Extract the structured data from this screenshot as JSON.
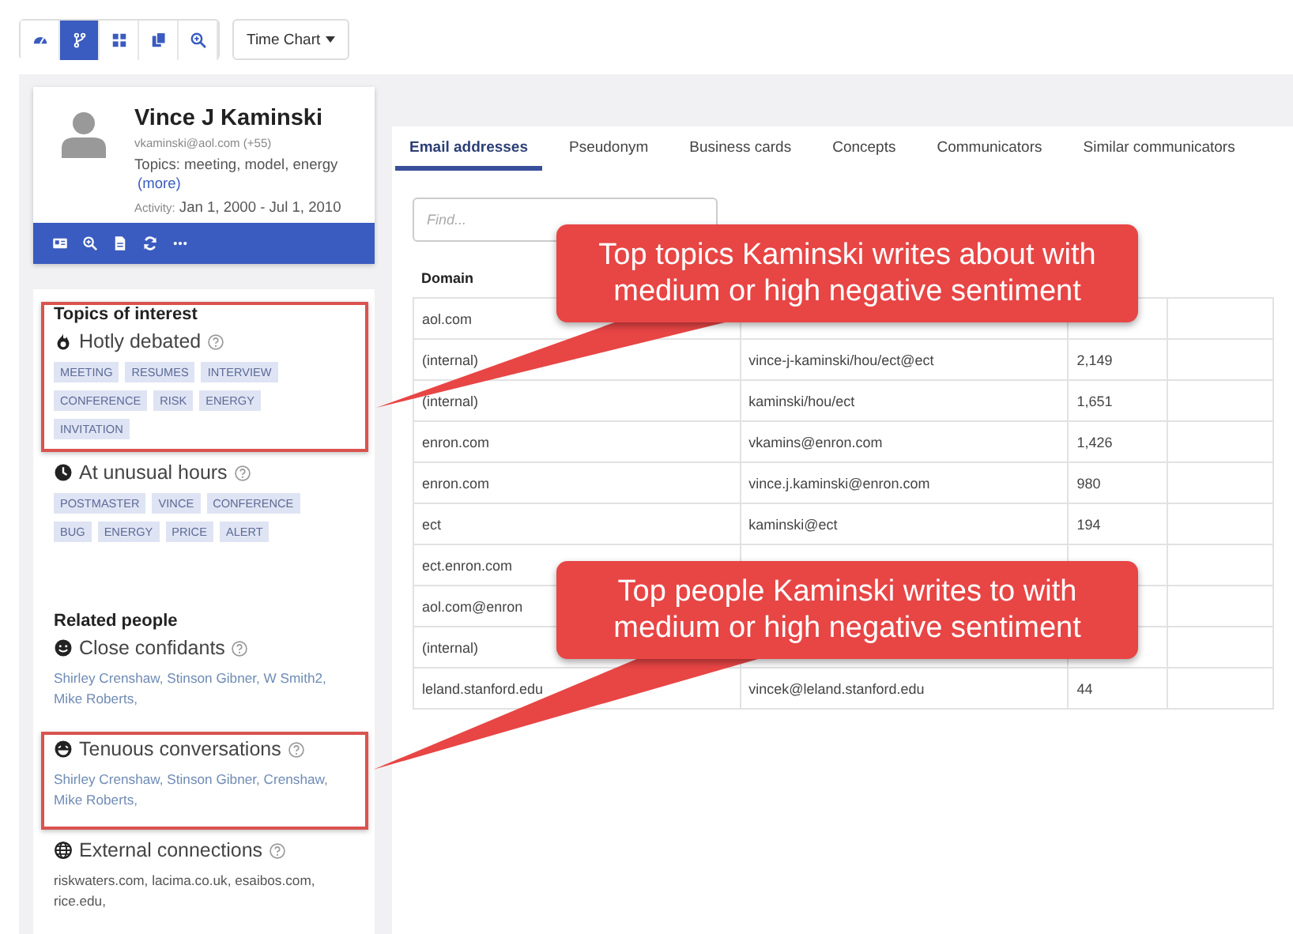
{
  "toolbar": {
    "buttons": [
      {
        "kind": "dashboard",
        "selected": false
      },
      {
        "kind": "branch",
        "selected": true
      },
      {
        "kind": "grid",
        "selected": false
      },
      {
        "kind": "copy",
        "selected": false
      },
      {
        "kind": "zoom",
        "selected": false
      }
    ],
    "dropdown": {
      "label": "Time Chart"
    }
  },
  "profile": {
    "name": "Vince J Kaminski",
    "email": "vkaminski@aol.com",
    "count": "(+55)",
    "topics": "Topics: meeting, model, energy",
    "more": "(more)",
    "activity_label": "Activity:",
    "activity": "Jan 1, 2000 - Jul 1, 2010",
    "actions": [
      {
        "kind": "card"
      },
      {
        "kind": "zoom"
      },
      {
        "kind": "document"
      },
      {
        "kind": "refresh"
      },
      {
        "kind": "more"
      }
    ]
  },
  "topics": {
    "title": "Topics of interest",
    "groups": [
      {
        "kind": "fire",
        "label": "Hotly debated",
        "highlighted": true,
        "tags": [
          "MEETING",
          "RESUMES",
          "INTERVIEW",
          "CONFERENCE",
          "RISK",
          "ENERGY",
          "INVITATION"
        ]
      },
      {
        "kind": "clock",
        "label": "At unusual hours",
        "highlighted": false,
        "tags": [
          "POSTMASTER",
          "VINCE",
          "CONFERENCE",
          "BUG",
          "ENERGY",
          "PRICE",
          "ALERT"
        ]
      }
    ]
  },
  "related": {
    "title": "Related people",
    "groups": [
      {
        "kind": "smile",
        "label": "Close confidants",
        "highlighted": false,
        "link": true,
        "text": "Shirley Crenshaw, Stinson Gibner, W Smith2, Mike Roberts,"
      },
      {
        "kind": "grin",
        "label": "Tenuous conversations",
        "highlighted": true,
        "link": true,
        "text": "Shirley Crenshaw, Stinson Gibner, Crenshaw, Mike Roberts,"
      },
      {
        "kind": "globe",
        "label": "External connections",
        "highlighted": false,
        "link": false,
        "text": "riskwaters.com, lacima.co.uk, esaibos.com, rice.edu,"
      }
    ]
  },
  "tabs": [
    {
      "label": "Email addresses",
      "selected": true
    },
    {
      "label": "Pseudonym",
      "selected": false
    },
    {
      "label": "Business cards",
      "selected": false
    },
    {
      "label": "Concepts",
      "selected": false
    },
    {
      "label": "Communicators",
      "selected": false
    },
    {
      "label": "Similar communicators",
      "selected": false
    }
  ],
  "search": {
    "placeholder": "Find..."
  },
  "table": {
    "columns": [
      "Domain"
    ],
    "rows": [
      {
        "domain": "aol.com"
      },
      {
        "domain": "(internal)",
        "address": "vince-j-kaminski/hou/ect@ect",
        "count": "2,149"
      },
      {
        "domain": "(internal)",
        "address": "kaminski/hou/ect",
        "count": "1,651"
      },
      {
        "domain": "enron.com",
        "address": "vkamins@enron.com",
        "count": "1,426"
      },
      {
        "domain": "enron.com",
        "address": "vince.j.kaminski@enron.com",
        "count": "980"
      },
      {
        "domain": "ect",
        "address": "kaminski@ect",
        "count": "194"
      },
      {
        "domain": "ect.enron.com"
      },
      {
        "domain": "aol.com@enron"
      },
      {
        "domain": "(internal)"
      },
      {
        "domain": "leland.stanford.edu",
        "address": "vincek@leland.stanford.edu",
        "count": "44"
      }
    ]
  },
  "callouts": [
    {
      "text": "Top topics Kaminski writes about with medium or high negative sentiment"
    },
    {
      "text": "Top people Kaminski writes to with medium or high negative sentiment"
    }
  ]
}
